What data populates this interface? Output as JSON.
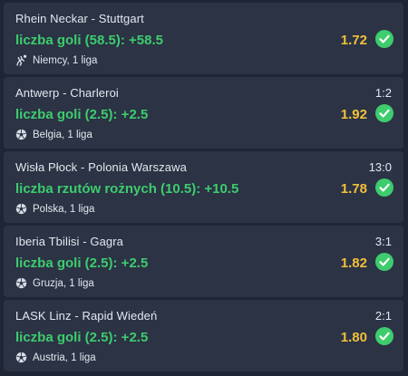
{
  "colors": {
    "background": "#1f2535",
    "card": "#2b3345",
    "market": "#3ecc6d",
    "odds": "#f2c03a",
    "check": "#3ecc6d"
  },
  "bets": [
    {
      "teams": "Rhein Neckar - Stuttgart",
      "score": "",
      "market": "liczba goli (58.5): +58.5",
      "odds": "1.72",
      "league": "Niemcy, 1 liga",
      "sport_icon": "handball-icon",
      "status_icon": "check-icon"
    },
    {
      "teams": "Antwerp - Charleroi",
      "score": "1:2",
      "market": "liczba goli (2.5): +2.5",
      "odds": "1.92",
      "league": "Belgia, 1 liga",
      "sport_icon": "soccer-ball-icon",
      "status_icon": "check-icon"
    },
    {
      "teams": "Wisła Płock - Polonia Warszawa",
      "score": "13:0",
      "market": "liczba rzutów rożnych (10.5): +10.5",
      "odds": "1.78",
      "league": "Polska, 1 liga",
      "sport_icon": "soccer-ball-icon",
      "status_icon": "check-icon"
    },
    {
      "teams": "Iberia Tbilisi - Gagra",
      "score": "3:1",
      "market": "liczba goli (2.5): +2.5",
      "odds": "1.82",
      "league": "Gruzja, 1 liga",
      "sport_icon": "soccer-ball-icon",
      "status_icon": "check-icon"
    },
    {
      "teams": "LASK Linz - Rapid Wiedeń",
      "score": "2:1",
      "market": "liczba goli (2.5): +2.5",
      "odds": "1.80",
      "league": "Austria, 1 liga",
      "sport_icon": "soccer-ball-icon",
      "status_icon": "check-icon"
    }
  ]
}
